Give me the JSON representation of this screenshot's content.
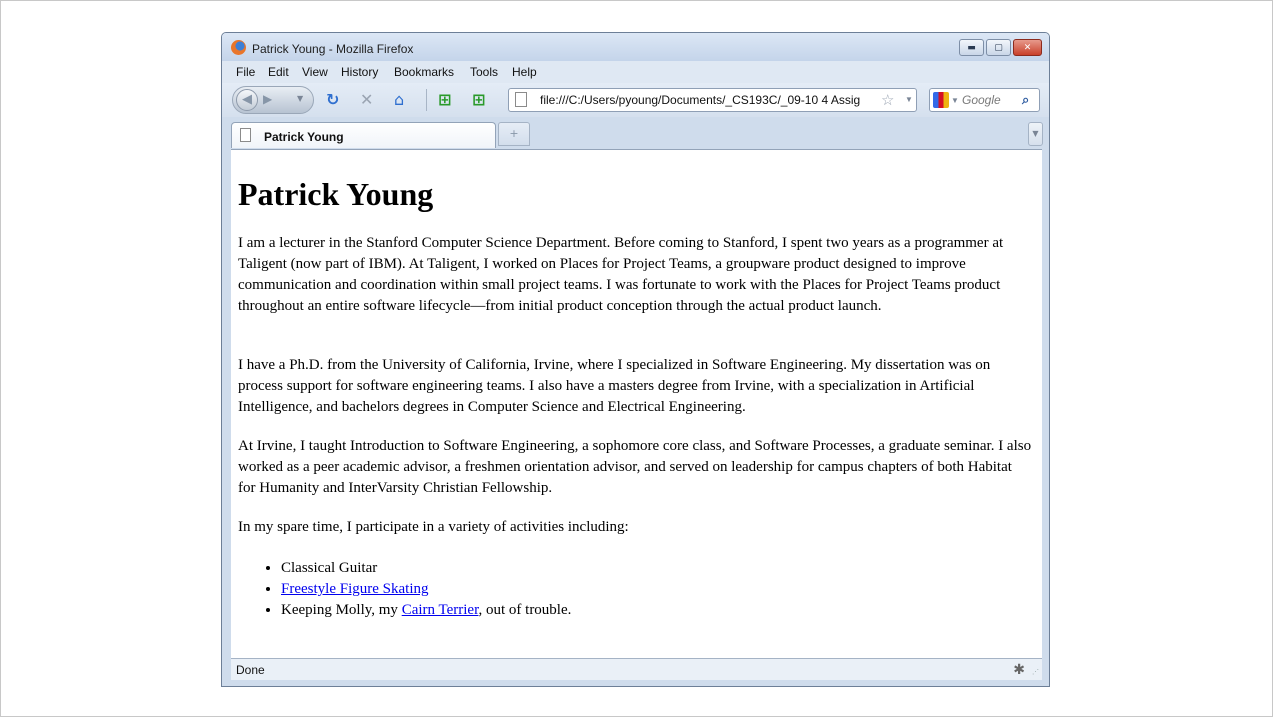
{
  "window": {
    "title": "Patrick Young - Mozilla Firefox",
    "minimize": "▬",
    "maximize": "▢",
    "close": "✕"
  },
  "menu": [
    "File",
    "Edit",
    "View",
    "History",
    "Bookmarks",
    "Tools",
    "Help"
  ],
  "nav": {
    "url": "file:///C:/Users/pyoung/Documents/_CS193C/_09-10 4 Assig",
    "search_placeholder": "Google"
  },
  "tab": {
    "label": "Patrick Young"
  },
  "page": {
    "heading": "Patrick Young",
    "p1": "I am a lecturer in the Stanford Computer Science Department. Before coming to Stanford, I spent two years as a programmer at Taligent (now part of IBM). At Taligent, I worked on Places for Project Teams, a groupware product designed to improve communication and coordination within small project teams. I was fortunate to work with the Places for Project Teams product throughout an entire software lifecycle—from initial product conception through the actual product launch.",
    "p2": "I have a Ph.D. from the University of California, Irvine, where I specialized in Software Engineering. My dissertation was on process support for software engineering teams. I also have a masters degree from Irvine, with a specialization in Artificial Intelligence, and bachelors degrees in Computer Science and Electrical Engineering.",
    "p3": "At Irvine, I taught Introduction to Software Engineering, a sophomore core class, and Software Processes, a graduate seminar. I also worked as a peer academic advisor, a freshmen orientation advisor, and served on leadership for campus chapters of both Habitat for Humanity and InterVarsity Christian Fellowship.",
    "p4": "In my spare time, I participate in a variety of activities including:",
    "list": {
      "item1": "Classical Guitar",
      "item2_link": "Freestyle Figure Skating",
      "item3_prefix": "Keeping Molly, my ",
      "item3_link": "Cairn Terrier",
      "item3_suffix": ", out of trouble."
    }
  },
  "status": {
    "text": "Done"
  },
  "colors": {
    "link": "#0000ee",
    "chrome": "#cfdcec"
  }
}
